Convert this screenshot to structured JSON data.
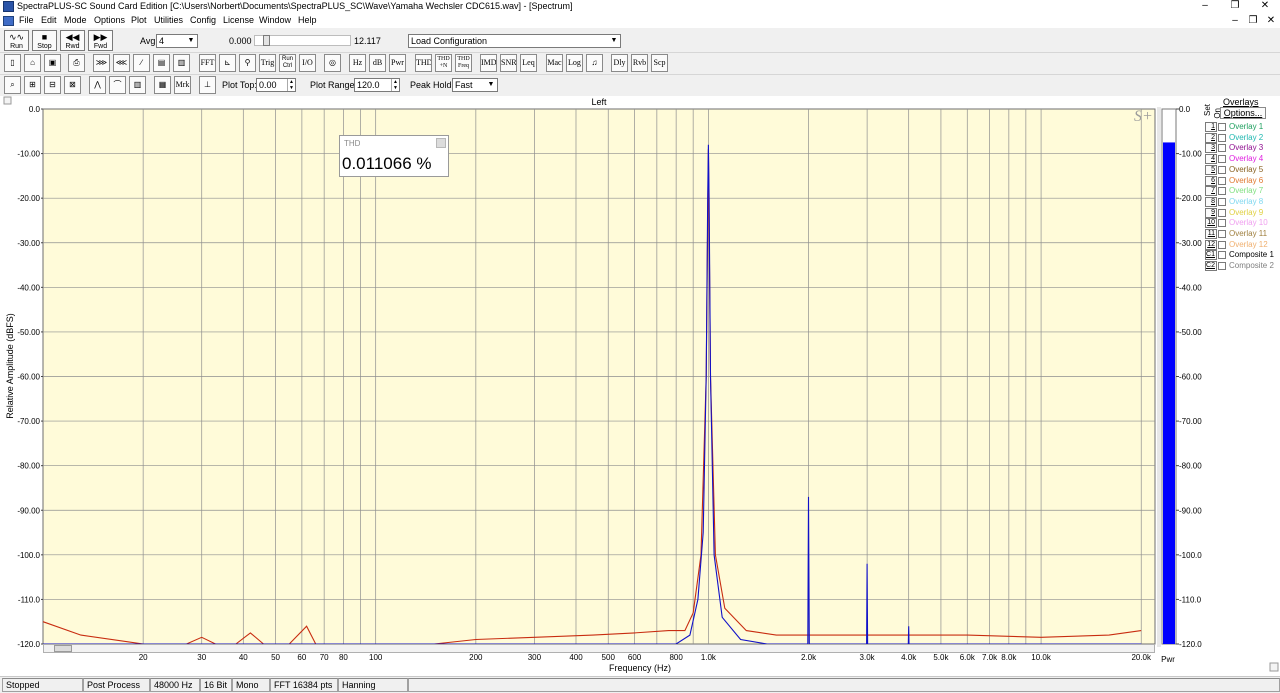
{
  "window": {
    "title": "SpectraPLUS-SC Sound Card Edition [C:\\Users\\Norbert\\Documents\\SpectraPLUS_SC\\Wave\\Yamaha Wechsler CDC615.wav] - [Spectrum]",
    "minimize": "–",
    "restore": "❐",
    "close": "✕"
  },
  "menu": {
    "items": [
      "File",
      "Edit",
      "Mode",
      "Options",
      "Plot",
      "Utilities",
      "Config",
      "License",
      "Window",
      "Help"
    ],
    "mdi_minimize": "–",
    "mdi_restore": "❐",
    "mdi_close": "✕"
  },
  "toolbar1": {
    "run": "Run",
    "stop": "Stop",
    "rwd": "Rwd",
    "fwd": "Fwd",
    "avg_label": "Avg",
    "avg_value": "4",
    "position_start": "0.000",
    "position_end": "12.117",
    "config_value": "Load Configuration"
  },
  "toolbar2": {
    "labels": [
      "FFT",
      "Trig",
      "Run Ctrl",
      "I/O",
      "Hz",
      "dB",
      "Pwr",
      "THD",
      "THD +N",
      "THD Freq",
      "IMD",
      "SNR",
      "Leq",
      "Mac",
      "Log",
      "Dly",
      "Rvb",
      "Scp"
    ]
  },
  "toolbar3": {
    "mrk": "Mrk",
    "plot_top_label": "Plot Top:",
    "plot_top_value": "0.00",
    "plot_range_label": "Plot Range:",
    "plot_range_value": "120.0",
    "peak_hold_label": "Peak Hold:",
    "peak_hold_value": "Fast"
  },
  "plot": {
    "channel_title": "Left",
    "ylabel": "Relative Amplitude (dBFS)",
    "xlabel": "Frequency (Hz)",
    "thd_title": "THD",
    "thd_value": "0.011066 %",
    "logo": "S+",
    "pwr_label": "Pwr",
    "colors": {
      "background": "#fffbd9",
      "grid": "#8e8e8e",
      "trace_left": "#1010c8",
      "trace_right": "#c82c10",
      "pwr_bar": "#0000ff"
    }
  },
  "chart_data": {
    "type": "line",
    "title": "Left",
    "xlabel": "Frequency (Hz)",
    "ylabel": "Relative Amplitude (dBFS)",
    "xscale": "log",
    "xlim": [
      10,
      22000
    ],
    "ylim": [
      -120,
      0
    ],
    "grid": true,
    "x_ticks": [
      "20",
      "30",
      "40",
      "50",
      "60",
      "70",
      "80",
      "100",
      "200",
      "300",
      "400",
      "500",
      "600",
      "800",
      "1.0k",
      "2.0k",
      "3.0k",
      "4.0k",
      "5.0k",
      "6.0k",
      "7.0k",
      "8.0k",
      "10.0k",
      "20.0k"
    ],
    "y_ticks": [
      "0.0",
      "-10.00",
      "-20.00",
      "-30.00",
      "-40.00",
      "-50.00",
      "-60.00",
      "-70.00",
      "-80.00",
      "-90.00",
      "-100.0",
      "-110.0",
      "-120.0"
    ],
    "series": [
      {
        "color": "#1010c8",
        "points": [
          [
            10,
            -120
          ],
          [
            150,
            -120
          ],
          [
            500,
            -120
          ],
          [
            800,
            -120
          ],
          [
            880,
            -118
          ],
          [
            930,
            -110
          ],
          [
            965,
            -95
          ],
          [
            985,
            -60
          ],
          [
            995,
            -20
          ],
          [
            1000,
            -8
          ],
          [
            1005,
            -20
          ],
          [
            1015,
            -60
          ],
          [
            1040,
            -100
          ],
          [
            1100,
            -114
          ],
          [
            1250,
            -119
          ],
          [
            1500,
            -120
          ],
          [
            1990,
            -120
          ],
          [
            2000,
            -87
          ],
          [
            2010,
            -120
          ],
          [
            2990,
            -120
          ],
          [
            3000,
            -102
          ],
          [
            3010,
            -120
          ],
          [
            3990,
            -120
          ],
          [
            4000,
            -116
          ],
          [
            4010,
            -120
          ],
          [
            20000,
            -120
          ]
        ]
      },
      {
        "color": "#c82c10",
        "points": [
          [
            10,
            -115
          ],
          [
            13,
            -118
          ],
          [
            20,
            -120
          ],
          [
            27,
            -120
          ],
          [
            30,
            -118.5
          ],
          [
            33,
            -120
          ],
          [
            38,
            -120
          ],
          [
            42,
            -117.5
          ],
          [
            46,
            -120
          ],
          [
            55,
            -120
          ],
          [
            62,
            -116
          ],
          [
            66,
            -120
          ],
          [
            150,
            -120
          ],
          [
            200,
            -119
          ],
          [
            300,
            -118.5
          ],
          [
            450,
            -118
          ],
          [
            600,
            -117.5
          ],
          [
            760,
            -117
          ],
          [
            850,
            -117
          ],
          [
            900,
            -113
          ],
          [
            950,
            -100
          ],
          [
            985,
            -60
          ],
          [
            1000,
            -9
          ],
          [
            1015,
            -60
          ],
          [
            1050,
            -100
          ],
          [
            1120,
            -112
          ],
          [
            1300,
            -117
          ],
          [
            1600,
            -118
          ],
          [
            2000,
            -118
          ],
          [
            3000,
            -118
          ],
          [
            4000,
            -118
          ],
          [
            6000,
            -118
          ],
          [
            10000,
            -118.5
          ],
          [
            16000,
            -118
          ],
          [
            20000,
            -117
          ]
        ]
      }
    ],
    "pwr_level_db": -7.5,
    "pwr_ticks": [
      "0.0",
      "-10.00",
      "-20.00",
      "-30.00",
      "-40.00",
      "-50.00",
      "-60.00",
      "-70.00",
      "-80.00",
      "-90.00",
      "-100.0",
      "-110.0",
      "-120.0"
    ]
  },
  "overlays": {
    "title": "Overlays",
    "options": "Options...",
    "set_label": "Set",
    "on_label": "On",
    "items": [
      {
        "num": "1",
        "name": "Overlay 1",
        "color": "#20a060"
      },
      {
        "num": "2",
        "name": "Overlay 2",
        "color": "#20b8b0"
      },
      {
        "num": "3",
        "name": "Overlay 3",
        "color": "#901090"
      },
      {
        "num": "4",
        "name": "Overlay 4",
        "color": "#e020e0"
      },
      {
        "num": "5",
        "name": "Overlay 5",
        "color": "#886020"
      },
      {
        "num": "6",
        "name": "Overlay 6",
        "color": "#e07830"
      },
      {
        "num": "7",
        "name": "Overlay 7",
        "color": "#80e080"
      },
      {
        "num": "8",
        "name": "Overlay 8",
        "color": "#80d8f0"
      },
      {
        "num": "9",
        "name": "Overlay 9",
        "color": "#e0d040"
      },
      {
        "num": "10",
        "name": "Overlay 10",
        "color": "#f0a0f0"
      },
      {
        "num": "11",
        "name": "Overlay 11",
        "color": "#a08040"
      },
      {
        "num": "12",
        "name": "Overlay 12",
        "color": "#f0b070"
      },
      {
        "num": "C1",
        "name": "Composite 1",
        "color": "#000000"
      },
      {
        "num": "C2",
        "name": "Composite 2",
        "color": "#808080"
      }
    ]
  },
  "status": {
    "items": [
      "Stopped",
      "Post Process",
      "48000 Hz",
      "16 Bit",
      "Mono",
      "FFT 16384 pts",
      "Hanning"
    ]
  }
}
